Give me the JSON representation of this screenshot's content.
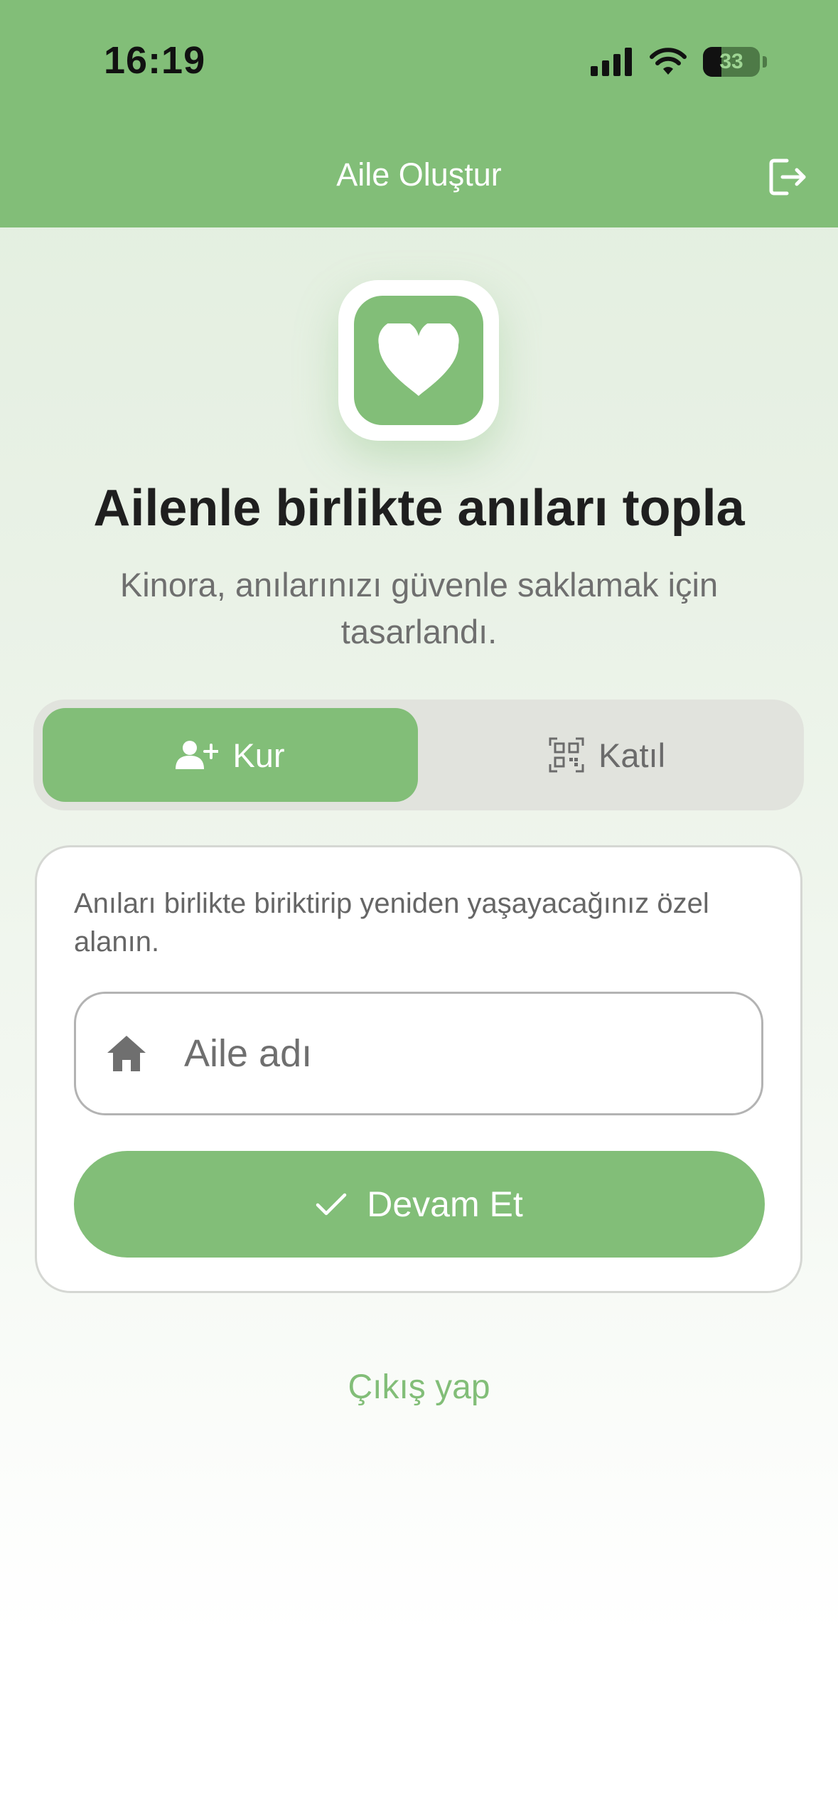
{
  "status_bar": {
    "time": "16:19",
    "battery_level": "33"
  },
  "header": {
    "title": "Aile Oluştur"
  },
  "hero": {
    "headline": "Ailenle birlikte anıları topla",
    "subtitle": "Kinora, anılarınızı güvenle saklamak için tasarlandı."
  },
  "segment": {
    "create_label": "Kur",
    "join_label": "Katıl",
    "selected": "Kur"
  },
  "card": {
    "description": "Anıları birlikte biriktirip yeniden yaşayacağınız özel alanın.",
    "family_name_placeholder": "Aile adı",
    "family_name_value": "",
    "continue_label": "Devam Et"
  },
  "footer": {
    "logout_label": "Çıkış yap"
  },
  "colors": {
    "accent": "#82be78",
    "header_bg": "#82be78",
    "segment_bg": "#e1e3dd",
    "text_dark": "#1f1f1f",
    "text_muted": "#6f6f6f"
  },
  "icons": {
    "header_right": "exit-icon",
    "app": "heart-icon",
    "create": "add-user-icon",
    "join": "qr-code-icon",
    "input": "home-icon",
    "continue": "checkmark-icon"
  }
}
